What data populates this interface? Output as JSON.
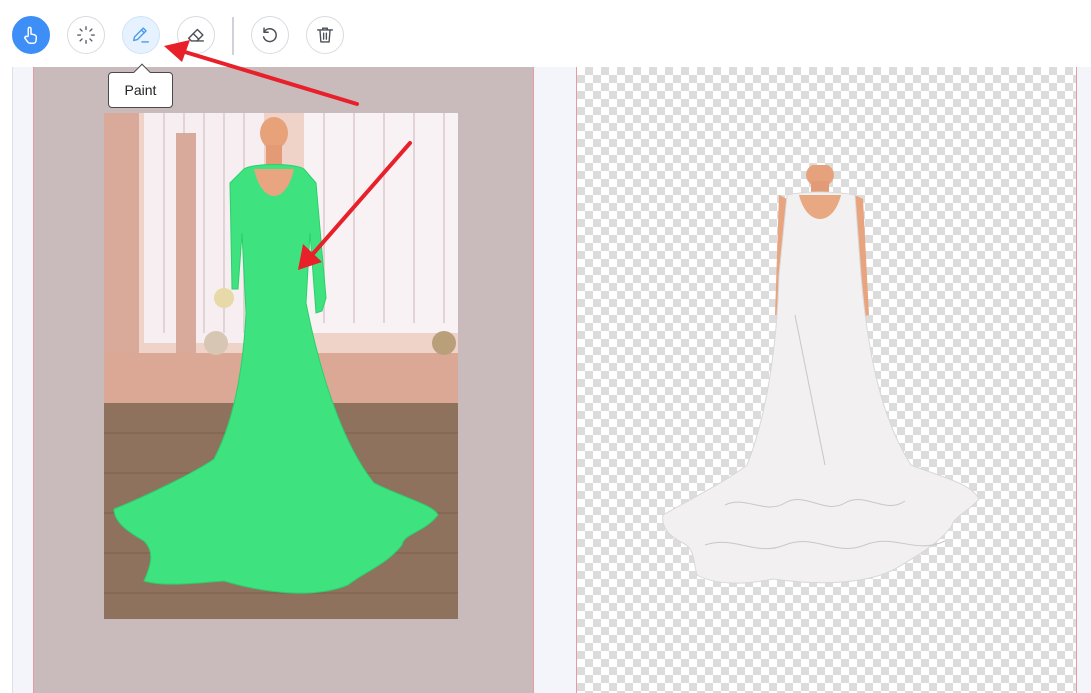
{
  "toolbar": {
    "tools": [
      {
        "id": "hand",
        "icon": "hand-pointer-icon"
      },
      {
        "id": "magic",
        "icon": "magic-wand-icon"
      },
      {
        "id": "paint",
        "icon": "pencil-icon"
      },
      {
        "id": "erase",
        "icon": "eraser-icon"
      },
      {
        "id": "undo",
        "icon": "undo-icon"
      },
      {
        "id": "delete",
        "icon": "trash-icon"
      }
    ],
    "active_tool": "paint",
    "tooltip": "Paint"
  },
  "colors": {
    "primary": "#3d8ef7",
    "mask_overlay": "#3ee27e",
    "canvas_bg": "#c9babc",
    "annotation_arrow": "#e8202a"
  }
}
